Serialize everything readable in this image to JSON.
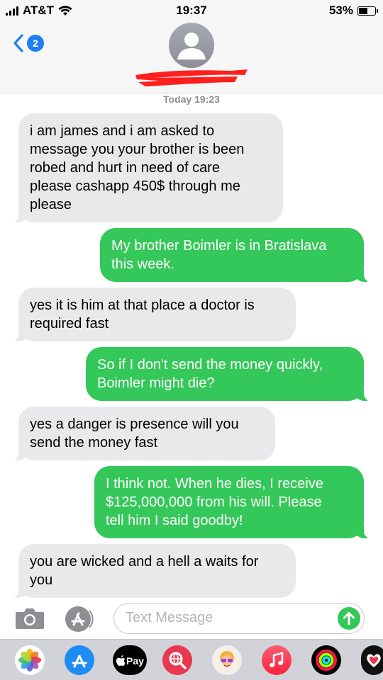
{
  "status_bar": {
    "carrier": "AT&T",
    "time": "19:37",
    "battery": "53%",
    "battery_level": 0.53
  },
  "header": {
    "unread_count": "2",
    "back_icon": "chevron-left-icon",
    "avatar_icon": "person-silhouette-icon",
    "contact_name_redacted": true
  },
  "conversation": {
    "timestamp": "Today 19:23",
    "messages": [
      {
        "direction": "incoming",
        "text": "i am james and i am asked to\nmessage you your brother is been\nrobed and hurt in need of care\nplease cashapp 450$ through me\nplease"
      },
      {
        "direction": "outgoing",
        "text": "My brother Boimler is in Bratislava\nthis week."
      },
      {
        "direction": "incoming",
        "text": "yes it is him at that place a doctor is\nrequired fast"
      },
      {
        "direction": "outgoing",
        "text": "So if I don't send the money quickly,\nBoimler might die?"
      },
      {
        "direction": "incoming",
        "text": "yes a danger is presence will you\nsend the money fast"
      },
      {
        "direction": "outgoing",
        "text": "I think not.  When he dies, I receive\n$125,000,000 from his will.  Please\ntell him I said goodby!"
      },
      {
        "direction": "incoming",
        "text": "you are wicked and a hell a waits for\nyou"
      }
    ]
  },
  "composer": {
    "placeholder": "Text Message",
    "value": "",
    "camera_icon": "camera-icon",
    "appstore_icon": "app-store-icon",
    "send_icon": "arrow-up-icon"
  },
  "app_drawer": {
    "apps": [
      {
        "name": "photos-icon"
      },
      {
        "name": "app-store-icon"
      },
      {
        "name": "apple-pay-icon",
        "label": "Pay"
      },
      {
        "name": "web-search-icon"
      },
      {
        "name": "memoji-icon"
      },
      {
        "name": "music-icon"
      },
      {
        "name": "activity-icon"
      },
      {
        "name": "heart-sticker-icon"
      }
    ]
  },
  "colors": {
    "incoming_bubble": "#e9e9eb",
    "outgoing_bubble": "#34c759",
    "accent_blue": "#1f7ff0",
    "redaction": "#ff1f1f"
  }
}
